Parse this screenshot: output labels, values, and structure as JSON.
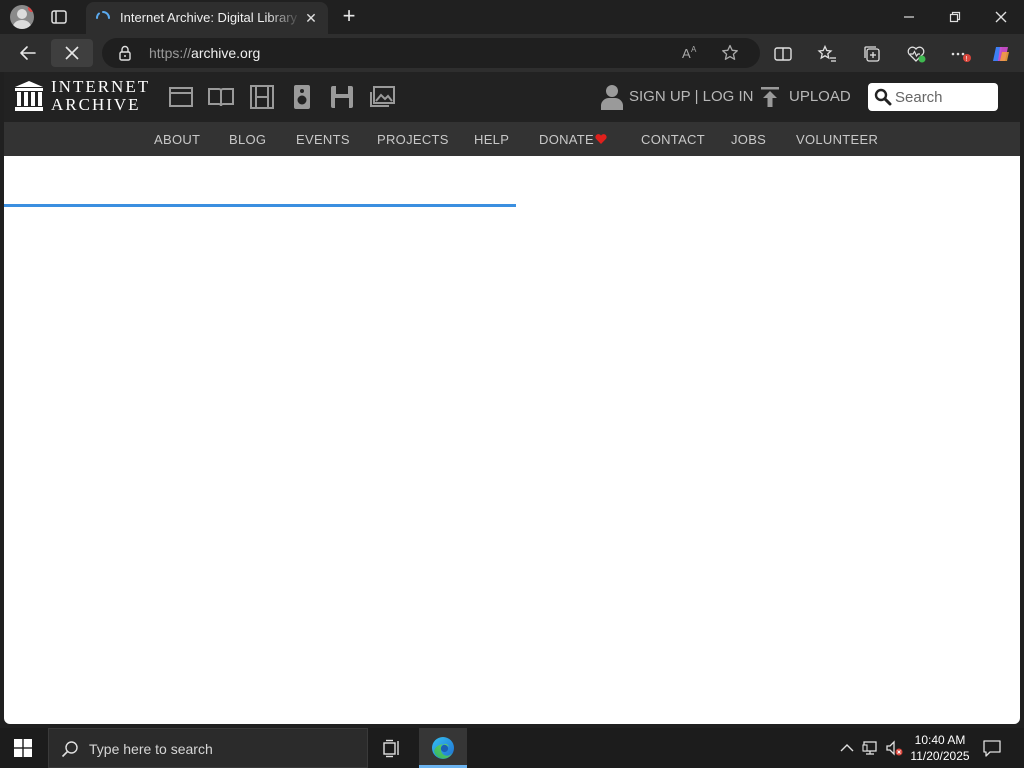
{
  "browser": {
    "tab_title": "Internet Archive: Digital Library of Free & Borrowable Books, Movies, Music & Wayback Machine",
    "url_prefix": "https://",
    "url_host": "archive.org"
  },
  "site": {
    "logo_line1": "INTERNET",
    "logo_line2": "ARCHIVE",
    "account_label": "SIGN UP | LOG IN",
    "upload_label": "UPLOAD",
    "search_placeholder": "Search",
    "nav": [
      {
        "label": "ABOUT"
      },
      {
        "label": "BLOG"
      },
      {
        "label": "EVENTS"
      },
      {
        "label": "PROJECTS"
      },
      {
        "label": "HELP"
      },
      {
        "label": "DONATE"
      },
      {
        "label": "CONTACT"
      },
      {
        "label": "JOBS"
      },
      {
        "label": "VOLUNTEER"
      }
    ],
    "media_icons": [
      "web-icon",
      "texts-icon",
      "video-icon",
      "audio-icon",
      "software-icon",
      "images-icon"
    ]
  },
  "taskbar": {
    "search_placeholder": "Type here to search",
    "time": "10:40 AM",
    "date": "11/20/2025"
  },
  "colors": {
    "ia_header": "#222222",
    "ia_nav": "#333333",
    "progress": "#3b8fe0",
    "donate_heart": "#e0201c"
  }
}
